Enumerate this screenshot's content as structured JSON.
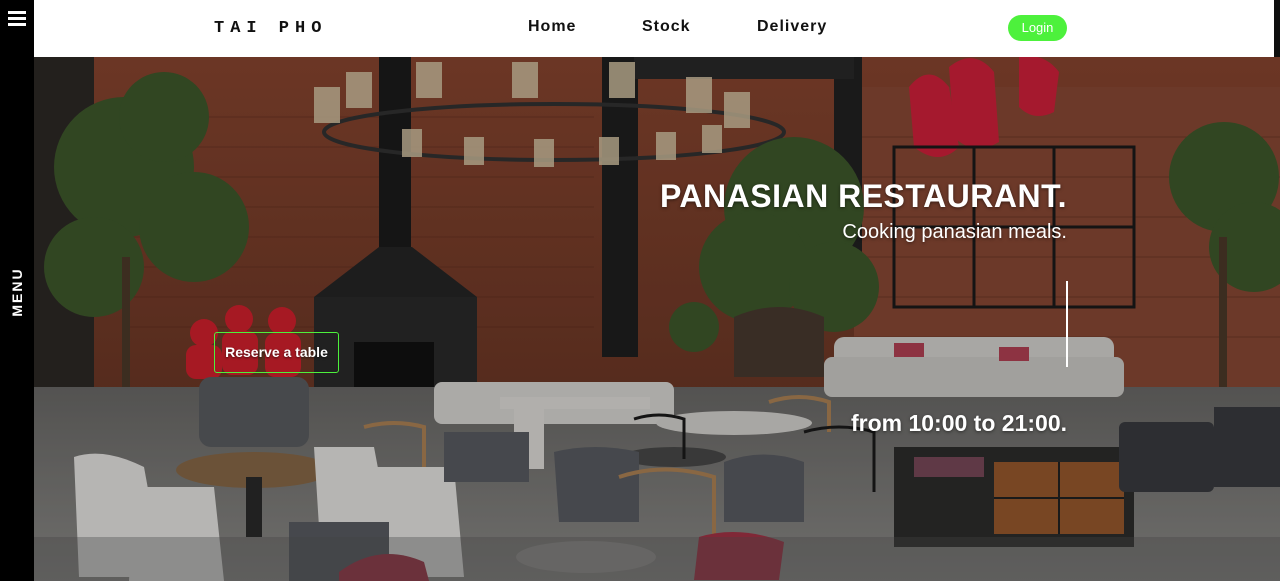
{
  "menu": {
    "label": "MENU",
    "icon": "hamburger-icon"
  },
  "header": {
    "logo": "TAI PHO",
    "nav": [
      {
        "label": "Home"
      },
      {
        "label": "Stock"
      },
      {
        "label": "Delivery"
      }
    ],
    "login_label": "Login",
    "accent_color": "#4df13c"
  },
  "hero": {
    "title": "PANASIAN RESTAURANT.",
    "subtitle": "Cooking panasian meals.",
    "hours": "from 10:00 to 21:00.",
    "reserve_label": "Reserve a table"
  }
}
